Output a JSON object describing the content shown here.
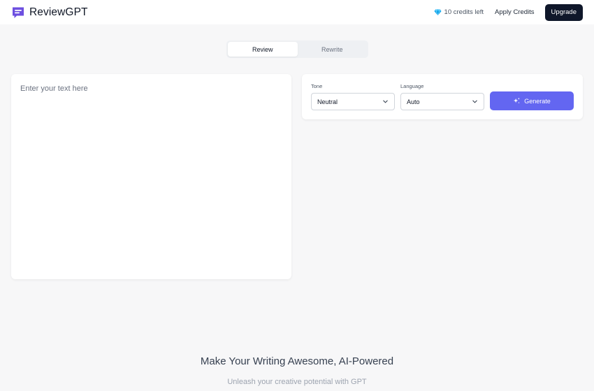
{
  "header": {
    "app_name": "ReviewGPT",
    "logo_icon": "chat-bubble-icon",
    "credits_icon": "gem-icon",
    "credits_text": "10 credits left",
    "apply_credits_label": "Apply Credits",
    "upgrade_label": "Upgrade"
  },
  "tabs": [
    {
      "label": "Review",
      "active": true
    },
    {
      "label": "Rewrite",
      "active": false
    }
  ],
  "editor": {
    "placeholder": "Enter your text here",
    "value": ""
  },
  "controls": {
    "tone_label": "Tone",
    "tone_value": "Neutral",
    "language_label": "Language",
    "language_value": "Auto",
    "generate_label": "Generate",
    "generate_icon": "sparkle-icon"
  },
  "hero": {
    "title": "Make Your Writing Awesome, AI-Powered",
    "subtitle": "Unleash your creative potential with GPT"
  },
  "colors": {
    "accent": "#6366f1",
    "upgrade_bg": "#0f172a",
    "page_bg": "#f7f7f8",
    "logo": "#6d4fe0"
  }
}
